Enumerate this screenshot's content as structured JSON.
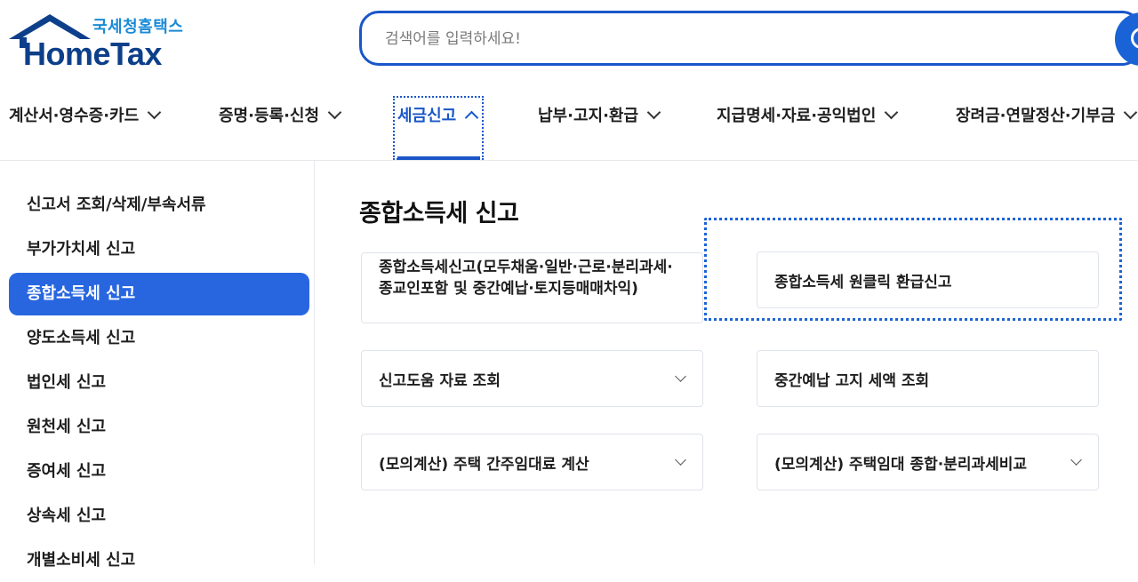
{
  "header": {
    "logo_korean": "국세청홈택스",
    "logo_english": "HomeTax",
    "search_placeholder": "검색어를 입력하세요!"
  },
  "gnb": {
    "items": [
      {
        "label": "계산서·영수증·카드",
        "active": false
      },
      {
        "label": "증명·등록·신청",
        "active": false
      },
      {
        "label": "세금신고",
        "active": true
      },
      {
        "label": "납부·고지·환급",
        "active": false
      },
      {
        "label": "지급명세·자료·공익법인",
        "active": false
      },
      {
        "label": "장려금·연말정산·기부금",
        "active": false
      }
    ]
  },
  "sidebar": {
    "items": [
      {
        "label": "신고서 조회/삭제/부속서류",
        "active": false
      },
      {
        "label": "부가가치세 신고",
        "active": false
      },
      {
        "label": "종합소득세 신고",
        "active": true
      },
      {
        "label": "양도소득세 신고",
        "active": false
      },
      {
        "label": "법인세 신고",
        "active": false
      },
      {
        "label": "원천세 신고",
        "active": false
      },
      {
        "label": "증여세 신고",
        "active": false
      },
      {
        "label": "상속세 신고",
        "active": false
      },
      {
        "label": "개별소비세 신고",
        "active": false
      }
    ]
  },
  "main": {
    "title": "종합소득세 신고",
    "cards": [
      {
        "label": "종합소득세신고(모두채움·일반·근로·분리과세·종교인포함 및 중간예납·토지등매매차익)",
        "has_chevron": false
      },
      {
        "label": "종합소득세 원클릭 환급신고",
        "has_chevron": false,
        "focused": true
      },
      {
        "label": "신고도움 자료 조회",
        "has_chevron": true
      },
      {
        "label": "중간예납 고지 세액 조회",
        "has_chevron": false
      },
      {
        "label": "(모의계산) 주택 간주임대료 계산",
        "has_chevron": true
      },
      {
        "label": "(모의계산) 주택임대 종합·분리과세비교",
        "has_chevron": true
      }
    ]
  },
  "colors": {
    "brand_blue": "#1a56c8",
    "active_menu_bg": "#2866e0",
    "logo_navy": "#0d3f8a",
    "logo_sky": "#1a8ad6"
  }
}
